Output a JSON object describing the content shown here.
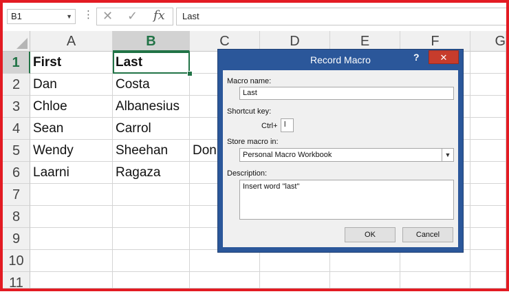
{
  "formula_bar": {
    "name_box": "B1",
    "cancel_glyph": "✕",
    "enter_glyph": "✓",
    "fx_label": "fx",
    "content": "Last"
  },
  "sheet": {
    "columns": [
      "A",
      "B",
      "C",
      "D",
      "E",
      "F",
      "G"
    ],
    "rows": [
      "1",
      "2",
      "3",
      "4",
      "5",
      "6",
      "7",
      "8",
      "9",
      "10",
      "11"
    ],
    "selected_cell": "B1",
    "cells": {
      "A1": "First",
      "B1": "Last",
      "A2": "Dan",
      "B2": "Costa",
      "A3": "Chloe",
      "B3": "Albanesius",
      "A4": "Sean",
      "B4": "Carrol",
      "A5": "Wendy",
      "B5": "Sheehan",
      "C5": "Don",
      "A6": "Laarni",
      "B6": "Ragaza"
    }
  },
  "dialog": {
    "title": "Record Macro",
    "help": "?",
    "close": "✕",
    "macro_name_label": "Macro name:",
    "macro_name_value": "Last",
    "shortcut_label": "Shortcut key:",
    "ctrl_label": "Ctrl+",
    "shortcut_value": "l",
    "store_label": "Store macro in:",
    "store_value": "Personal Macro Workbook",
    "description_label": "Description:",
    "description_value": "Insert word \"last\"",
    "ok_label": "OK",
    "cancel_label": "Cancel"
  },
  "colors": {
    "excel_green": "#217346",
    "dialog_blue": "#2b579a",
    "close_red": "#c73c2c",
    "frame_red": "#e31b23"
  }
}
